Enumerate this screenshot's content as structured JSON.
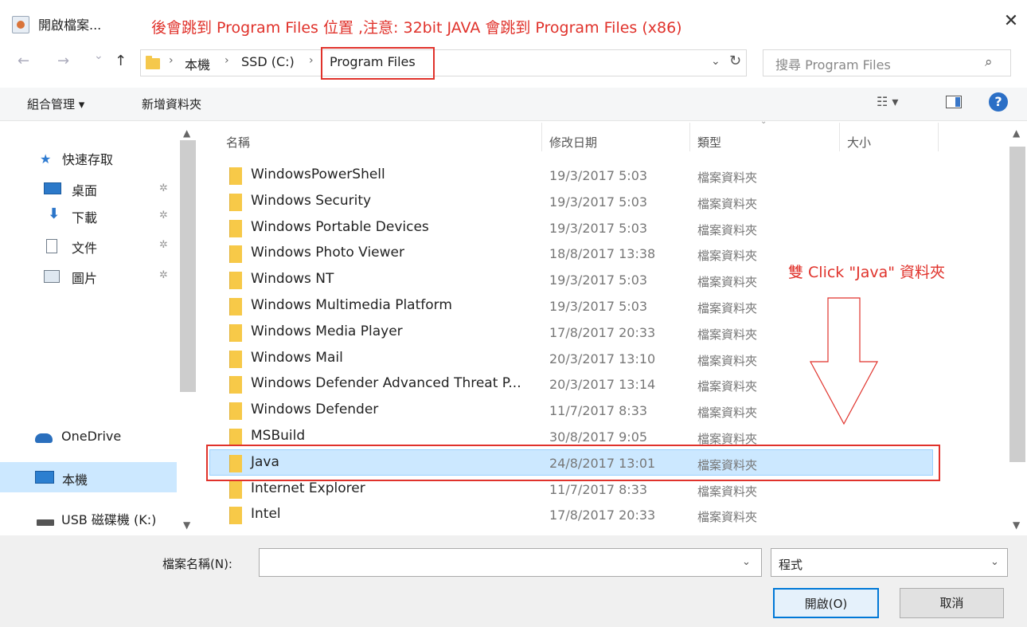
{
  "window": {
    "title": "開啟檔案...",
    "close_glyph": "✕",
    "annotation_top": "後會跳到 Program Files  位置 ,注意:  32bit  JAVA 會跳到 Program Files (x86)"
  },
  "nav": {
    "back": "←",
    "forward": "→",
    "recent": "⌄",
    "up": "↑"
  },
  "address": {
    "crumbs": [
      "本機",
      "SSD (C:)",
      "Program Files"
    ],
    "separator": "›",
    "dropdown": "⌄",
    "refresh": "↻"
  },
  "search": {
    "placeholder": "搜尋 Program Files",
    "icon": "⌕"
  },
  "toolbar": {
    "organize": "組合管理 ▾",
    "new_folder": "新增資料夾",
    "view_glyph": "☷ ▾",
    "help": "?"
  },
  "sidebar": {
    "quick_access": "快速存取",
    "items": [
      {
        "label": "桌面"
      },
      {
        "label": "下載"
      },
      {
        "label": "文件"
      },
      {
        "label": "圖片"
      }
    ],
    "pin": "✲",
    "onedrive": "OneDrive",
    "this_pc": "本機",
    "usb": "USB 磁碟機 (K:)"
  },
  "columns": {
    "name": "名稱",
    "date": "修改日期",
    "type": "類型",
    "size": "大小"
  },
  "files": [
    {
      "name": "WindowsPowerShell",
      "date": "19/3/2017 5:03",
      "type": "檔案資料夾"
    },
    {
      "name": "Windows Security",
      "date": "19/3/2017 5:03",
      "type": "檔案資料夾"
    },
    {
      "name": "Windows Portable Devices",
      "date": "19/3/2017 5:03",
      "type": "檔案資料夾"
    },
    {
      "name": "Windows Photo Viewer",
      "date": "18/8/2017 13:38",
      "type": "檔案資料夾"
    },
    {
      "name": "Windows NT",
      "date": "19/3/2017 5:03",
      "type": "檔案資料夾"
    },
    {
      "name": "Windows Multimedia Platform",
      "date": "19/3/2017 5:03",
      "type": "檔案資料夾"
    },
    {
      "name": "Windows Media Player",
      "date": "17/8/2017 20:33",
      "type": "檔案資料夾"
    },
    {
      "name": "Windows Mail",
      "date": "20/3/2017 13:10",
      "type": "檔案資料夾"
    },
    {
      "name": "Windows Defender Advanced Threat P...",
      "date": "20/3/2017 13:14",
      "type": "檔案資料夾"
    },
    {
      "name": "Windows Defender",
      "date": "11/7/2017 8:33",
      "type": "檔案資料夾"
    },
    {
      "name": "MSBuild",
      "date": "30/8/2017 9:05",
      "type": "檔案資料夾"
    },
    {
      "name": "Java",
      "date": "24/8/2017 13:01",
      "type": "檔案資料夾"
    },
    {
      "name": "Internet Explorer",
      "date": "11/7/2017 8:33",
      "type": "檔案資料夾"
    },
    {
      "name": "Intel",
      "date": "17/8/2017 20:33",
      "type": "檔案資料夾"
    }
  ],
  "annotation_right": "雙 Click \"Java\" 資料夾",
  "annotation_color": "#e0322b",
  "bottom": {
    "filename_label": "檔案名稱(N):",
    "filename_value": "",
    "filetype": "程式",
    "dropdown": "⌄",
    "open": "開啟(O)",
    "cancel": "取消"
  }
}
